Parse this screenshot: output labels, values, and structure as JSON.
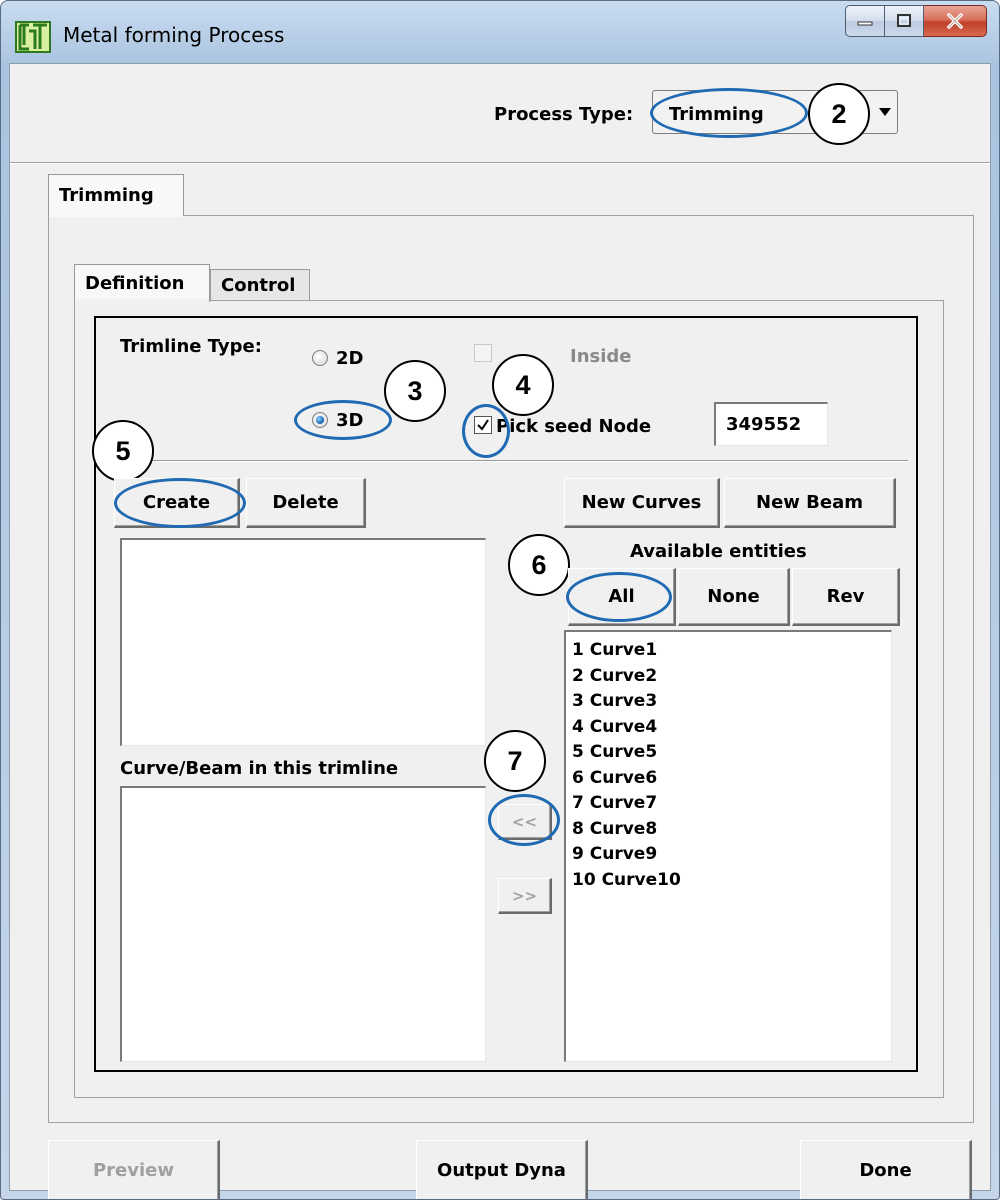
{
  "window": {
    "title": "Metal forming Process"
  },
  "header": {
    "process_type_label": "Process Type:",
    "process_type_value": "Trimming"
  },
  "tabs": {
    "outer": "Trimming",
    "definition": "Definition",
    "control": "Control"
  },
  "trimline": {
    "type_label": "Trimline Type:",
    "option_2d": "2D",
    "option_3d": "3D",
    "selected": "3D",
    "inside_label": "Inside",
    "pick_seed_label": "Pick seed Node",
    "pick_seed_checked": true,
    "seed_node_value": "349552"
  },
  "buttons": {
    "create": "Create",
    "delete": "Delete",
    "new_curves": "New Curves",
    "new_beam": "New Beam",
    "all": "All",
    "none": "None",
    "rev": "Rev",
    "move_left": "<<",
    "move_right": ">>",
    "preview": "Preview",
    "output_dyna": "Output Dyna",
    "done": "Done"
  },
  "labels": {
    "available_entities": "Available entities",
    "curve_beam_in_trimline": "Curve/Beam in this trimline"
  },
  "available_entities": [
    "1 Curve1",
    "2 Curve2",
    "3 Curve3",
    "4 Curve4",
    "5 Curve5",
    "6 Curve6",
    "7 Curve7",
    "8 Curve8",
    "9 Curve9",
    "10 Curve10"
  ],
  "callouts": {
    "c2": "2",
    "c3": "3",
    "c4": "4",
    "c5": "5",
    "c6": "6",
    "c7": "7"
  },
  "colors": {
    "highlight_ring": "#1f6ab3",
    "radio_selected": "#1b6fb8",
    "close_button": "#c0412a"
  }
}
